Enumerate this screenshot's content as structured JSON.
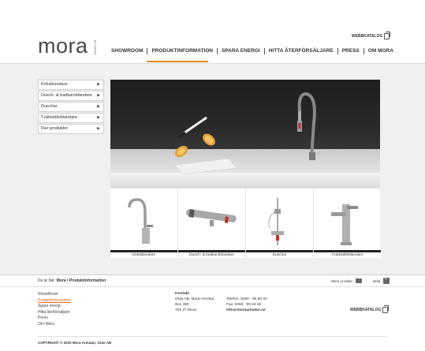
{
  "brand": {
    "logo_text": "mora",
    "logo_sub": "ARMATUR"
  },
  "header": {
    "webkatalog_label": "WEBBKATALOG",
    "nav": [
      "SHOWROOM",
      "PRODUKTINFORMATION",
      "SPARA ENERGI",
      "HITTA ÅTERFÖRSÄLJARE",
      "PRESS",
      "OM MORA"
    ],
    "active_nav": "PRODUKTINFORMATION",
    "accent_color": "#e88a1e"
  },
  "sidebar": {
    "items": [
      {
        "label": "Köksblandare"
      },
      {
        "label": "Dusch- & badkarsblandare"
      },
      {
        "label": "Duschar"
      },
      {
        "label": "Tvättställsblandare"
      },
      {
        "label": "Fler produkter"
      }
    ]
  },
  "thumbnails": [
    {
      "label": "Köksblandare"
    },
    {
      "label": "Dusch- & badkarsblandare"
    },
    {
      "label": "Duschar"
    },
    {
      "label": "Tvättställsblandare"
    }
  ],
  "breadcrumb": {
    "prefix": "Du är här:",
    "path": "Mora / Produktinformation"
  },
  "tools": {
    "print_label": "Skriv ut sidan",
    "share_label": "Dela"
  },
  "footer": {
    "links": [
      "ShowRoom",
      "Produktinformation",
      "Spara energi",
      "Hitta återförsäljare",
      "Press",
      "Om Mora"
    ],
    "active_link": "Produktinformation",
    "contact_title": "Kontakt",
    "contact_lines": [
      "Oras AB, Mora Armatur",
      "Box 480",
      "792 27 Mora"
    ],
    "phone": "Telefon: 0250 - 59 60 00",
    "fax": "Fax: 0250 - 59 64 60",
    "email": "info@moraarmatur.se",
    "webkatalog_label": "WEBBKATALOG",
    "copyright": "COPYRIGHT © 2010 Mora Armatur, Oras AB"
  }
}
